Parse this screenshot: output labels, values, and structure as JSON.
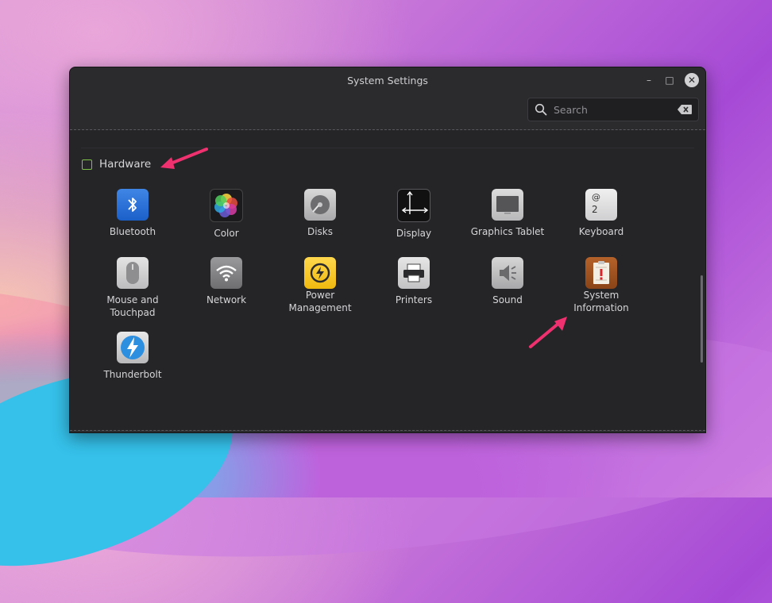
{
  "window": {
    "title": "System Settings",
    "minimize_label": "–",
    "maximize_label": "□",
    "close_label": "✕"
  },
  "search": {
    "placeholder": "Search"
  },
  "section": {
    "title": "Hardware"
  },
  "items": [
    {
      "label": "Bluetooth",
      "icon": "bluetooth-icon"
    },
    {
      "label": "Color",
      "icon": "color-icon"
    },
    {
      "label": "Disks",
      "icon": "disks-icon"
    },
    {
      "label": "Display",
      "icon": "display-icon"
    },
    {
      "label": "Graphics Tablet",
      "icon": "graphics-tablet-icon"
    },
    {
      "label": "Keyboard",
      "icon": "keyboard-icon"
    },
    {
      "label": "Mouse and\nTouchpad",
      "icon": "mouse-icon"
    },
    {
      "label": "Network",
      "icon": "network-icon"
    },
    {
      "label": "Power\nManagement",
      "icon": "power-icon"
    },
    {
      "label": "Printers",
      "icon": "printer-icon"
    },
    {
      "label": "Sound",
      "icon": "sound-icon"
    },
    {
      "label": "System\nInformation",
      "icon": "system-information-icon"
    },
    {
      "label": "Thunderbolt",
      "icon": "thunderbolt-icon"
    }
  ],
  "keyboard_icon_text": {
    "top": "@",
    "bottom": "2"
  },
  "colors": {
    "accent_arrow": "#f0316f",
    "section_icon": "#7ec24a",
    "window_bg": "#2b2b2e"
  }
}
